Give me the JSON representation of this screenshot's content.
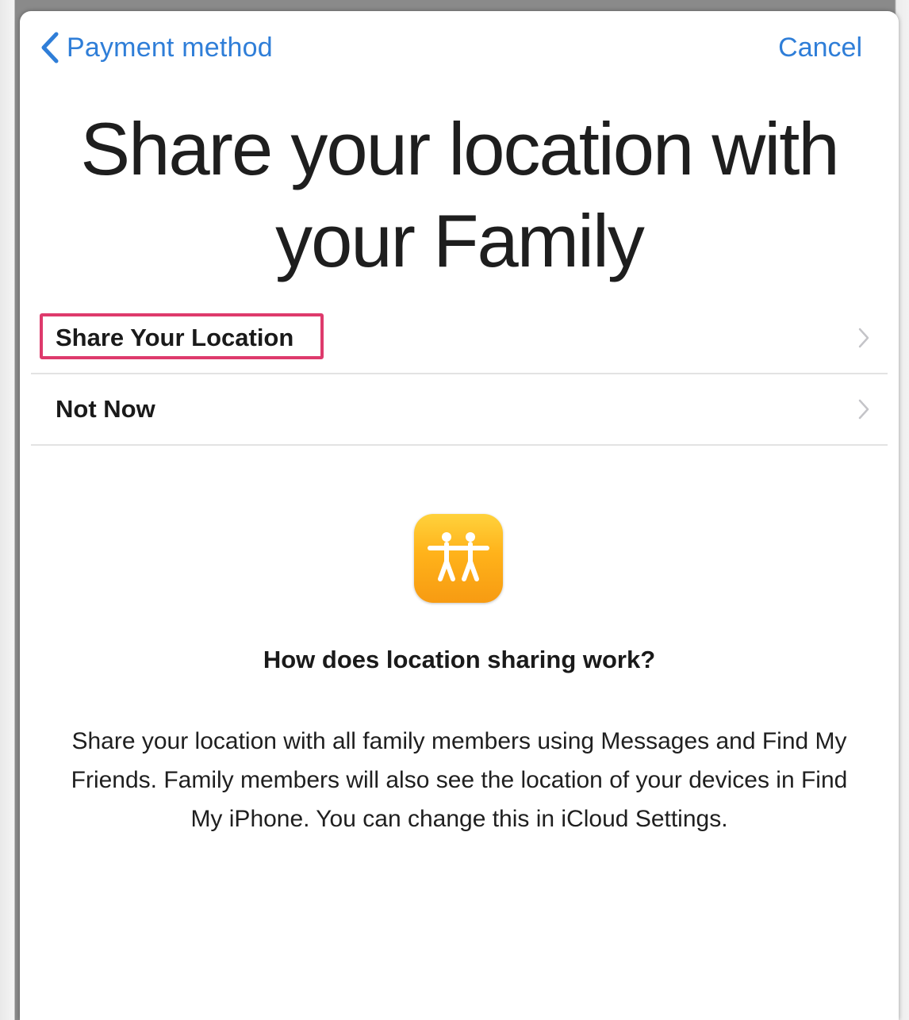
{
  "nav": {
    "back_label": "Payment method",
    "cancel_label": "Cancel"
  },
  "title": "Share your location with your Family",
  "options": [
    {
      "label": "Share Your Location",
      "highlighted": true
    },
    {
      "label": "Not Now",
      "highlighted": false
    }
  ],
  "info": {
    "icon": "find-my-friends-icon",
    "heading": "How does location sharing work?",
    "body": "Share your location with all family members using Messages and Find My Friends. Family members will also see the location of your devices in Find My iPhone. You can change this in iCloud Settings."
  },
  "colors": {
    "accent": "#2f7ed8",
    "highlight_border": "#de3a6c",
    "icon_gradient_top": "#ffd23c",
    "icon_gradient_bottom": "#f79b12"
  }
}
